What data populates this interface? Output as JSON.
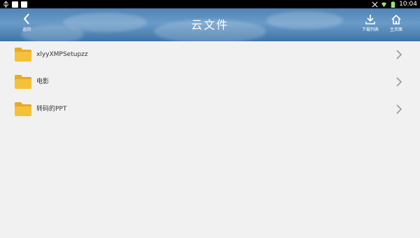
{
  "status_bar": {
    "time": "10:04",
    "icons": [
      "usb-icon",
      "notification-icon",
      "notification-icon",
      "signal-mute-icon",
      "wifi-icon",
      "battery-icon"
    ]
  },
  "header": {
    "title": "云文件",
    "back_label": "返回",
    "download_label": "下载列表",
    "home_label": "主页面"
  },
  "folders": [
    {
      "name": "xlyyXMPSetupzz"
    },
    {
      "name": "电影"
    },
    {
      "name": "转码的PPT"
    }
  ],
  "colors": {
    "header_blue": "#4f84b6",
    "folder_yellow": "#f6c13a",
    "background": "#f1f1f1"
  }
}
